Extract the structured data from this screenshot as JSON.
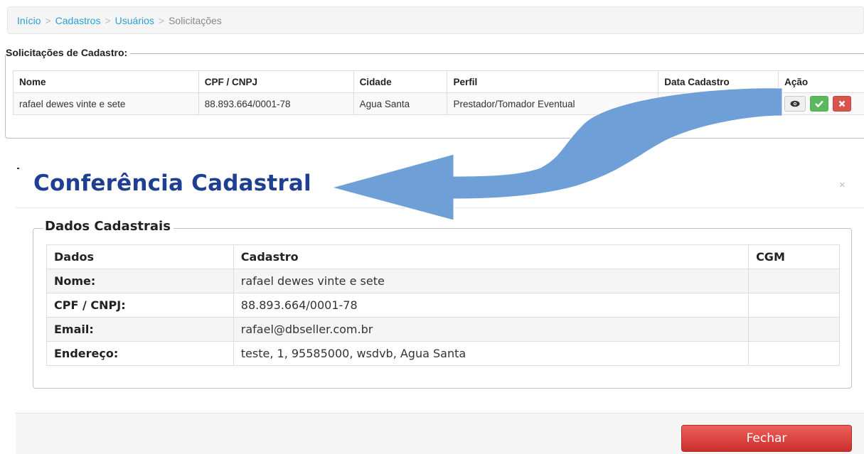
{
  "breadcrumb": {
    "items": [
      "Início",
      "Cadastros",
      "Usuários"
    ],
    "current": "Solicitações",
    "separator": ">"
  },
  "requests": {
    "legend": "Solicitações de Cadastro:",
    "columns": [
      "Nome",
      "CPF / CNPJ",
      "Cidade",
      "Perfil",
      "Data Cadastro",
      "Ação"
    ],
    "rows": [
      {
        "nome": "rafael dewes vinte e sete",
        "cpf_cnpj": "88.893.664/0001-78",
        "cidade": "Agua Santa",
        "perfil": "Prestador/Tomador Eventual",
        "data_cadastro": "",
        "actions": {
          "view_icon": "eye-icon",
          "approve_icon": "check-icon",
          "reject_icon": "close-icon"
        }
      }
    ]
  },
  "modal": {
    "title": "Conferência Cadastral",
    "close_glyph": "×",
    "legend": "Dados Cadastrais",
    "columns": [
      "Dados",
      "Cadastro",
      "CGM"
    ],
    "rows": [
      {
        "label": "Nome:",
        "value": "rafael dewes vinte e sete",
        "cgm": ""
      },
      {
        "label": "CPF / CNPJ:",
        "value": "88.893.664/0001-78",
        "cgm": ""
      },
      {
        "label": "Email:",
        "value": "rafael@dbseller.com.br",
        "cgm": ""
      },
      {
        "label": "Endereço:",
        "value": "teste, 1, 95585000, wsdvb, Agua Santa",
        "cgm": ""
      }
    ],
    "close_button": "Fechar"
  },
  "colors": {
    "link": "#2a9fd6",
    "title": "#1f3f93",
    "arrow": "#6e9fd6",
    "approve": "#5cb85c",
    "reject": "#d9534f"
  }
}
